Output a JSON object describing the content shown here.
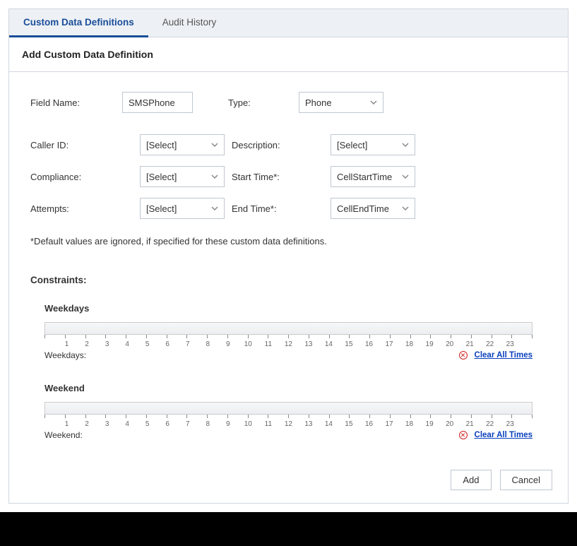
{
  "tabs": {
    "custom": "Custom Data Definitions",
    "audit": "Audit History"
  },
  "header": "Add Custom Data Definition",
  "form": {
    "field_name_label": "Field Name:",
    "field_name_value": "SMSPhone",
    "type_label": "Type:",
    "type_value": "Phone",
    "caller_id_label": "Caller ID:",
    "caller_id_value": "[Select]",
    "description_label": "Description:",
    "description_value": "[Select]",
    "compliance_label": "Compliance:",
    "compliance_value": "[Select]",
    "start_time_label": "Start Time*:",
    "start_time_value": "CellStartTime",
    "attempts_label": "Attempts:",
    "attempts_value": "[Select]",
    "end_time_label": "End Time*:",
    "end_time_value": "CellEndTime",
    "note": "*Default values are ignored, if specified for these custom data definitions."
  },
  "constraints": {
    "title": "Constraints:",
    "weekdays_title": "Weekdays",
    "weekdays_label": "Weekdays:",
    "weekend_title": "Weekend",
    "weekend_label": "Weekend:",
    "clear_link": "Clear All Times",
    "hours": [
      "1",
      "2",
      "3",
      "4",
      "5",
      "6",
      "7",
      "8",
      "9",
      "10",
      "11",
      "12",
      "13",
      "14",
      "15",
      "16",
      "17",
      "18",
      "19",
      "20",
      "21",
      "22",
      "23"
    ]
  },
  "buttons": {
    "add": "Add",
    "cancel": "Cancel"
  }
}
